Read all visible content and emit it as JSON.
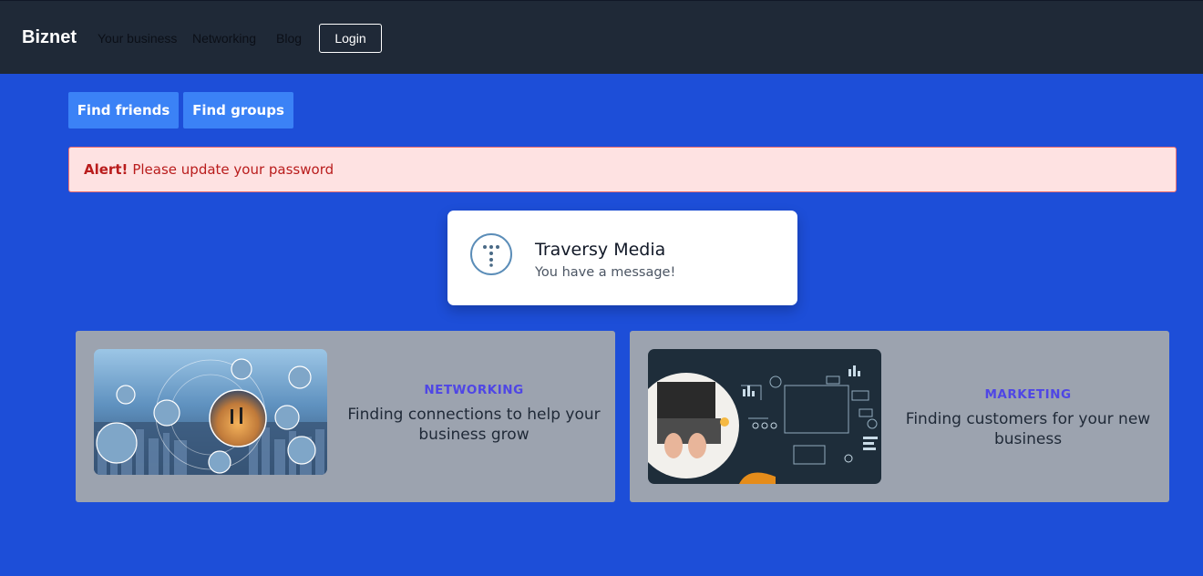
{
  "navbar": {
    "brand": "Biznet",
    "links": [
      "Your business",
      "Networking",
      "Blog"
    ],
    "login_label": "Login"
  },
  "actions": {
    "find_friends": "Find friends",
    "find_groups": "Find groups"
  },
  "alert": {
    "title": "Alert!",
    "message": "Please update your password"
  },
  "notification": {
    "title": "Traversy Media",
    "message": "You have a message!"
  },
  "cards": [
    {
      "category": "NETWORKING",
      "description": "Finding connections to help your business grow"
    },
    {
      "category": "MARKETING",
      "description": "Finding customers for your new business"
    }
  ],
  "colors": {
    "background": "#1d4ed8",
    "navbar": "#1f2937",
    "button": "#3b82f6",
    "alert_bg": "#fee2e2",
    "alert_text": "#b91c1c",
    "card_bg": "#9ca3af",
    "category": "#4f46e5"
  }
}
